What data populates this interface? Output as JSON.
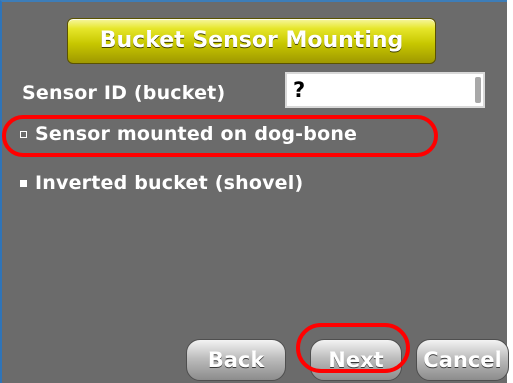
{
  "window": {
    "title": "Bucket Sensor Mounting"
  },
  "sensor": {
    "label": "Sensor ID (bucket)",
    "value": "?"
  },
  "options": [
    {
      "label": "Sensor mounted on dog-bone",
      "selected": false
    },
    {
      "label": "Inverted bucket (shovel)",
      "selected": true
    }
  ],
  "buttons": {
    "back": "Back",
    "next": "Next",
    "cancel": "Cancel"
  },
  "colors": {
    "title_bar": "#c7c700",
    "background": "#6b6b6b",
    "highlight": "#ff0000"
  }
}
